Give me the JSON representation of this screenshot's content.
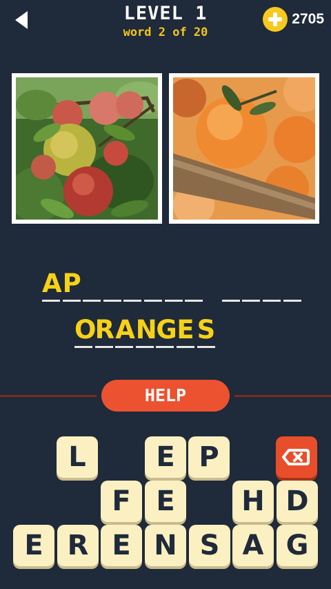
{
  "header": {
    "level_title": "LEVEL 1",
    "word_progress": "word 2 of 20",
    "coins": "2705"
  },
  "images": [
    {
      "subject": "apples-on-tree-photo"
    },
    {
      "subject": "oranges-in-crate-photo"
    }
  ],
  "answer": {
    "word1": [
      "A",
      "P",
      "",
      "",
      "",
      "",
      "",
      ""
    ],
    "word2": [
      "",
      "",
      "",
      ""
    ],
    "word3": [
      "O",
      "R",
      "A",
      "N",
      "G",
      "E",
      "S"
    ]
  },
  "help_label": "HELP",
  "keyboard": {
    "keys": [
      "L",
      "",
      "E",
      "P",
      "",
      "",
      "F",
      "E",
      "",
      "H",
      "D",
      "E",
      "R",
      "E",
      "N",
      "S",
      "A",
      "G"
    ],
    "delete_icon": "backspace-icon"
  },
  "colors": {
    "background": "#1f2a3a",
    "accent_yellow": "#f7d117",
    "help_orange": "#ec5230",
    "key_face": "#fbf0c2"
  }
}
